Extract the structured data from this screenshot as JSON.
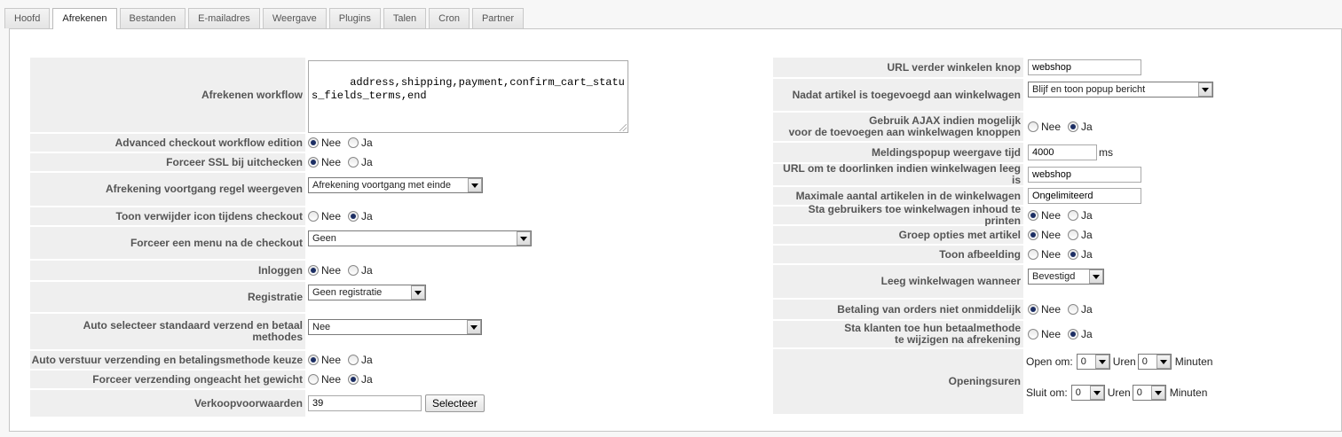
{
  "tabs": [
    "Hoofd",
    "Afrekenen",
    "Bestanden",
    "E-mailadres",
    "Weergave",
    "Plugins",
    "Talen",
    "Cron",
    "Partner"
  ],
  "active_tab": "Afrekenen",
  "radio_labels": {
    "no": "Nee",
    "yes": "Ja"
  },
  "left": {
    "workflow": {
      "label": "Afrekenen workflow",
      "value": "address,shipping,payment,confirm_cart_status_fields_terms,end"
    },
    "advanced_workflow": {
      "label": "Advanced checkout workflow edition",
      "selected": "Nee"
    },
    "force_ssl": {
      "label": "Forceer SSL bij uitchecken",
      "selected": "Nee"
    },
    "progress_line": {
      "label": "Afrekening voortgang regel weergeven",
      "value": "Afrekening voortgang met einde"
    },
    "remove_icon": {
      "label": "Toon verwijder icon tijdens checkout",
      "selected": "Ja"
    },
    "force_menu": {
      "label": "Forceer een menu na de checkout",
      "value": "Geen"
    },
    "login": {
      "label": "Inloggen",
      "selected": "Nee"
    },
    "registration": {
      "label": "Registratie",
      "value": "Geen registratie"
    },
    "auto_select": {
      "label": "Auto selecteer standaard verzend en betaal methodes",
      "value": "Nee"
    },
    "auto_submit": {
      "label": "Auto verstuur verzending en betalingsmethode keuze",
      "selected": "Nee"
    },
    "force_shipping": {
      "label": "Forceer verzending ongeacht het gewicht",
      "selected": "Ja"
    },
    "terms": {
      "label": "Verkoopvoorwaarden",
      "value": "39",
      "button": "Selecteer"
    }
  },
  "right": {
    "continue_url": {
      "label": "URL verder winkelen knop",
      "value": "webshop"
    },
    "after_add": {
      "label": "Nadat artikel is toegevoegd aan winkelwagen",
      "value": "Blijf en toon popup bericht"
    },
    "use_ajax": {
      "label_line1": "Gebruik AJAX indien mogelijk",
      "label_line2": "voor de toevoegen aan winkelwagen knoppen",
      "selected": "Ja"
    },
    "popup_time": {
      "label": "Meldingspopup weergave tijd",
      "value": "4000",
      "unit": "ms"
    },
    "empty_cart_url": {
      "label": "URL om te doorlinken indien winkelwagen leeg is",
      "value": "webshop"
    },
    "max_items": {
      "label": "Maximale aantal artikelen in de winkelwagen",
      "value": "Ongelimiteerd"
    },
    "print_cart": {
      "label": "Sta gebruikers toe winkelwagen inhoud te printen",
      "selected": "Nee"
    },
    "group_options": {
      "label": "Groep opties met artikel",
      "selected": "Nee"
    },
    "show_image": {
      "label": "Toon afbeelding",
      "selected": "Ja"
    },
    "empty_cart_when": {
      "label": "Leeg winkelwagen wanneer",
      "value": "Bevestigd"
    },
    "payment_not_immediate": {
      "label": "Betaling van orders niet onmiddelijk",
      "selected": "Nee"
    },
    "change_payment": {
      "label_line1": "Sta klanten toe hun betaalmethode",
      "label_line2": "te wijzigen na afrekening",
      "selected": "Ja"
    },
    "opening_hours": {
      "label": "Openingsuren",
      "open_label": "Open om:",
      "open_hours": "0",
      "open_minutes": "0",
      "close_label": "Sluit om:",
      "close_hours": "0",
      "close_minutes": "0",
      "hours_unit": "Uren",
      "minutes_unit": "Minuten"
    }
  }
}
